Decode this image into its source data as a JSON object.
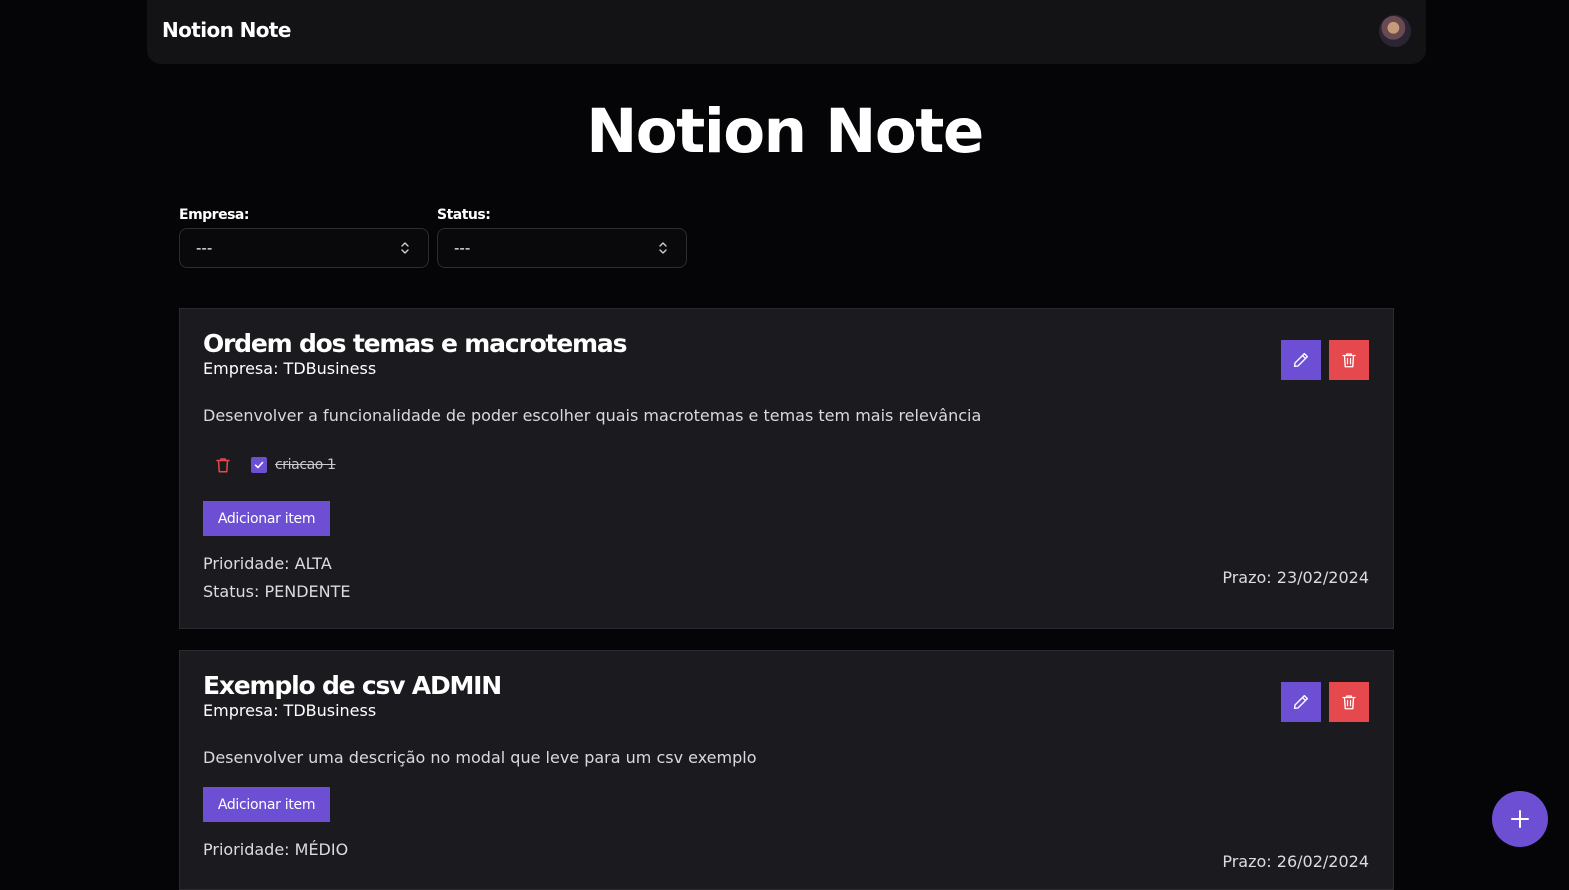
{
  "header": {
    "brand": "Notion Note",
    "avatar_icon": "user-avatar"
  },
  "page": {
    "title": "Notion Note"
  },
  "filters": {
    "empresa": {
      "label": "Empresa:",
      "value": "---"
    },
    "status": {
      "label": "Status:",
      "value": "---"
    }
  },
  "tasks": [
    {
      "title": "Ordem dos temas e macrotemas",
      "company": "Empresa: TDBusiness",
      "description": "Desenvolver a funcionalidade de poder escolher quais macrotemas e temas tem mais relevância",
      "checklist": [
        {
          "text": "criacao 1",
          "checked": true
        }
      ],
      "add_item_label": "Adicionar item",
      "priority": "Prioridade: ALTA",
      "status": "Status: PENDENTE",
      "deadline": "Prazo: 23/02/2024"
    },
    {
      "title": "Exemplo de csv ADMIN",
      "company": "Empresa: TDBusiness",
      "description": "Desenvolver uma descrição no modal que leve para um csv exemplo",
      "checklist": [],
      "add_item_label": "Adicionar item",
      "priority": "Prioridade: MÉDIO",
      "deadline": "Prazo: 26/02/2024"
    }
  ],
  "colors": {
    "accent": "#6d4fd4",
    "danger": "#e5484d",
    "background": "#050507",
    "card": "#1b1a1f"
  },
  "icons": {
    "edit": "pencil-icon",
    "delete": "trash-icon",
    "add": "plus-icon",
    "select": "chevron-up-down-icon",
    "check": "check-icon"
  }
}
